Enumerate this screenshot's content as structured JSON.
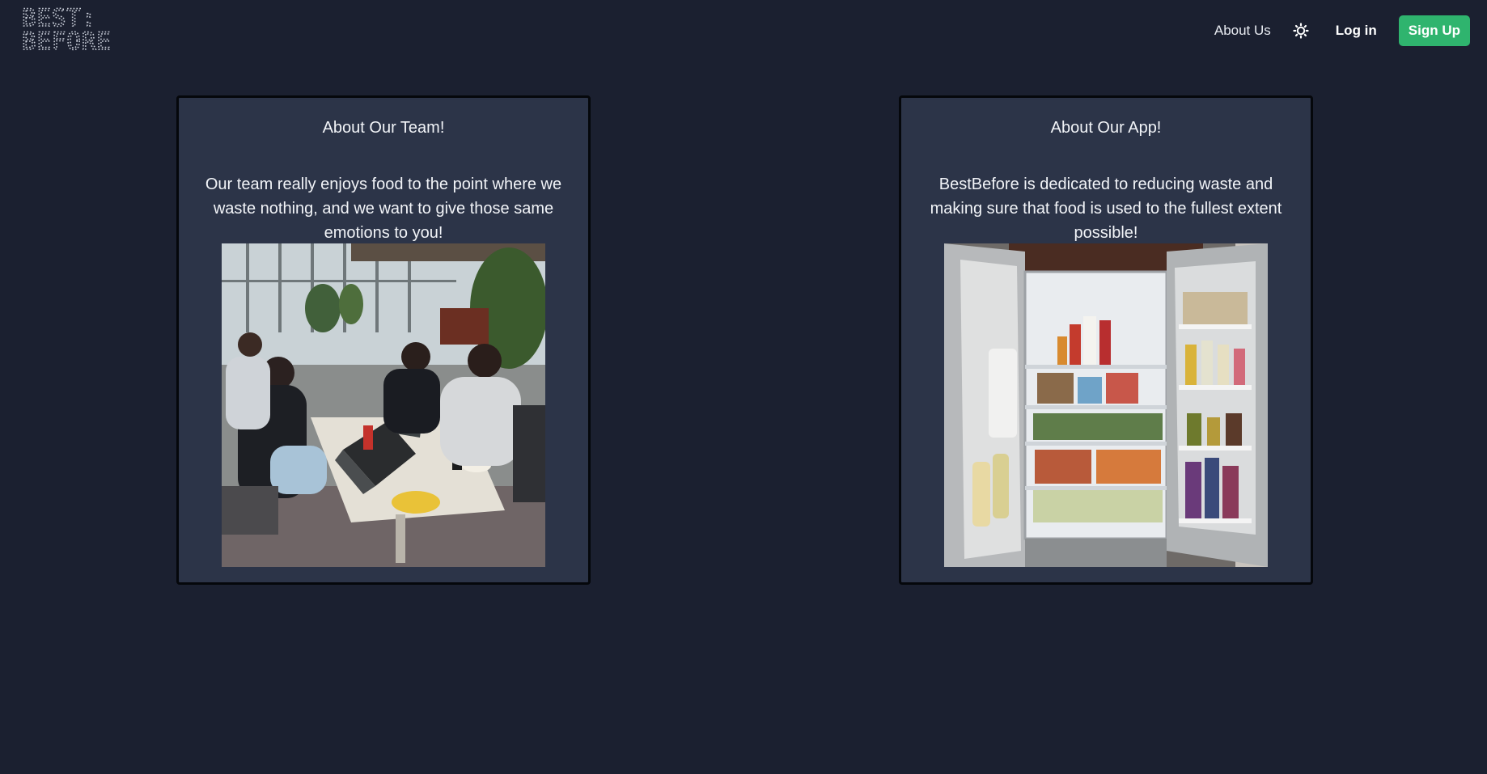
{
  "header": {
    "logo_line1": "BEST:",
    "logo_line2": "BEFORE",
    "nav": {
      "about_label": "About Us",
      "theme_icon": "sun-icon",
      "login_label": "Log in",
      "signup_label": "Sign Up"
    }
  },
  "colors": {
    "background": "#1b2030",
    "card_background": "#2c3448",
    "accent_green": "#2fb46e"
  },
  "cards": [
    {
      "title": "About Our Team!",
      "body": "Our team really enjoys food to the point where we waste nothing, and we want to give those same emotions to you!",
      "image_subject": "team-photo"
    },
    {
      "title": "About Our App!",
      "body": "BestBefore is dedicated to reducing waste and making sure that food is used to the fullest extent possible!",
      "image_subject": "refrigerator-photo"
    }
  ]
}
